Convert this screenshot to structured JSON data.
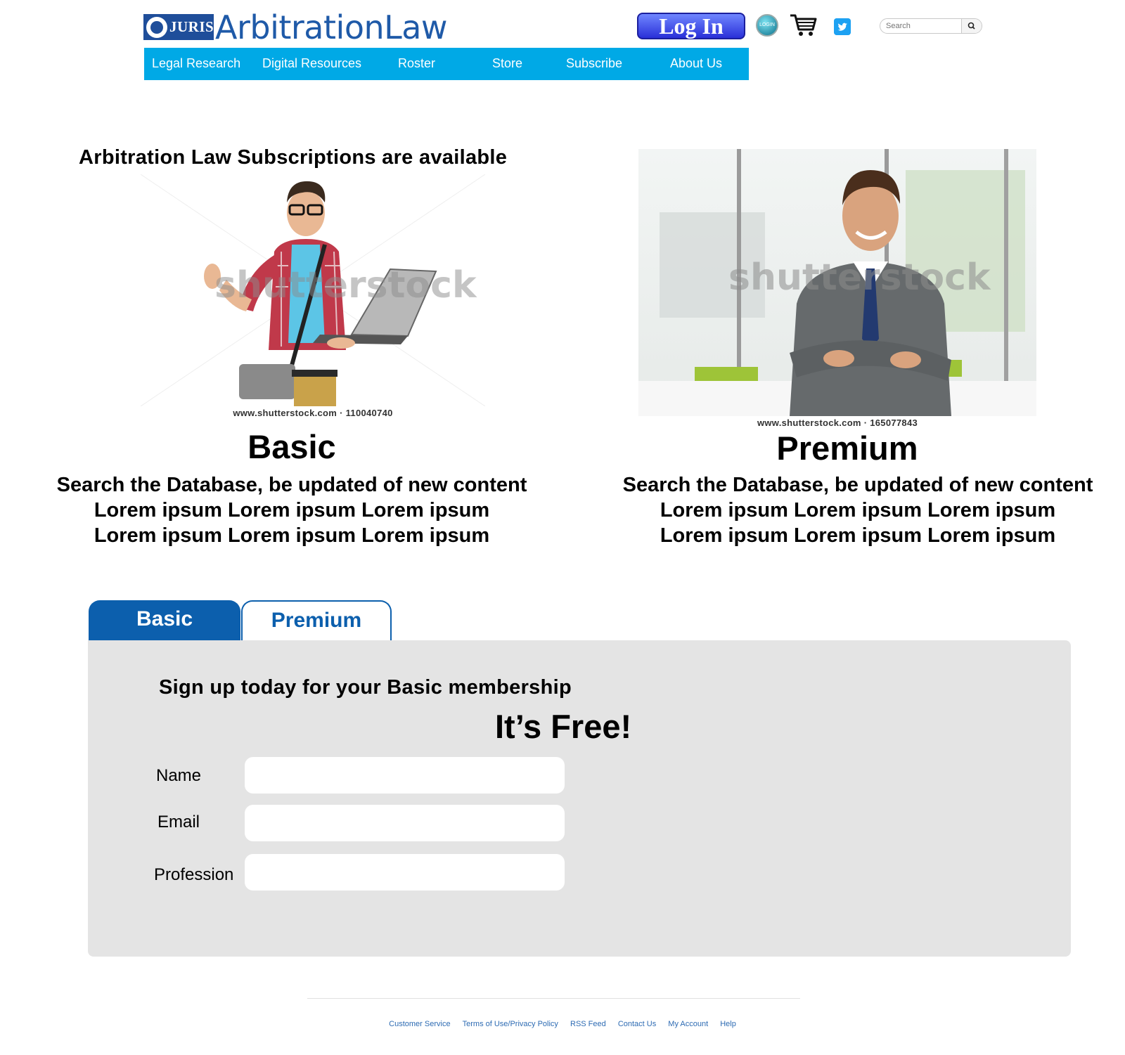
{
  "header": {
    "logo_text": "JURIS",
    "site_name": "ArbitrationLaw",
    "login_label": "Log In",
    "login_icon_text": "LOGIN",
    "search_placeholder": "Search"
  },
  "nav": {
    "items": [
      "Legal Research",
      "Digital Resources",
      "Roster",
      "Store",
      "Subscribe",
      "About Us"
    ],
    "background": "#00a9e6"
  },
  "promo": {
    "title": "Arbitration Law Subscriptions are available",
    "watermark": "shutterstock",
    "plans": [
      {
        "name": "Basic",
        "image_credit": "www.shutterstock.com · 110040740",
        "lines": [
          "Search the Database, be updated of new content",
          "Lorem ipsum Lorem ipsum Lorem ipsum",
          "Lorem ipsum Lorem ipsum Lorem ipsum"
        ]
      },
      {
        "name": "Premium",
        "image_credit": "www.shutterstock.com · 165077843",
        "lines": [
          "Search the Database, be updated of new content",
          "Lorem ipsum Lorem ipsum Lorem ipsum",
          "Lorem ipsum Lorem ipsum Lorem ipsum"
        ]
      }
    ]
  },
  "signup": {
    "tabs": [
      {
        "label": "Basic",
        "active": true
      },
      {
        "label": "Premium",
        "active": false
      }
    ],
    "heading": "Sign up today for your Basic membership",
    "subheading": "It’s Free!",
    "fields": [
      {
        "label": "Name",
        "value": ""
      },
      {
        "label": "Email",
        "value": ""
      },
      {
        "label": "Profession",
        "value": ""
      }
    ],
    "accent_color": "#0c5fad"
  },
  "footer": {
    "links": [
      "Customer Service",
      "Terms of Use/Privacy Policy",
      "RSS Feed",
      "Contact Us",
      "My Account",
      "Help"
    ]
  }
}
